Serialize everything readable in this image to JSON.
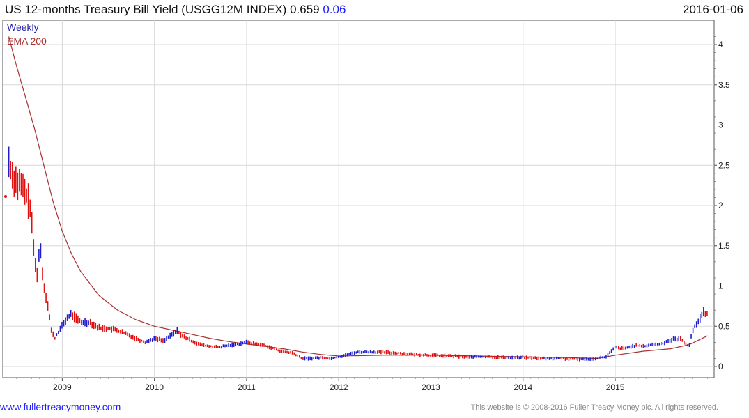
{
  "header": {
    "title": "US 12-months Treasury Bill Yield (USGG12M INDEX) 0.659",
    "change": "0.06",
    "date": "2016-01-06"
  },
  "legend": {
    "weekly": "Weekly",
    "ema": "EMA 200"
  },
  "footer": {
    "link": "www.fullertreacymoney.com",
    "copyright": "This website is © 2008-2016 Fuller Treacy Money plc. All rights reserved."
  },
  "colors": {
    "up_bar": "#1d1dcc",
    "down_bar": "#e01010",
    "ema_line": "#a83030",
    "grid": "#d8d8d8"
  },
  "chart_data": {
    "type": "line",
    "y_axis_side": "right",
    "ylim": [
      -0.1,
      4.3
    ],
    "yticks": [
      "0",
      "0.5",
      "1",
      "1.5",
      "2",
      "2.5",
      "3",
      "3.5",
      "4"
    ],
    "xticks": [
      "2009",
      "2010",
      "2011",
      "2012",
      "2013",
      "2014",
      "2015"
    ],
    "xlim": [
      2008.4,
      2016.02
    ],
    "grid": true,
    "series": [
      {
        "name": "Weekly",
        "x": [
          2008.42,
          2008.45,
          2008.5,
          2008.55,
          2008.6,
          2008.65,
          2008.68,
          2008.72,
          2008.76,
          2008.8,
          2008.84,
          2008.88,
          2008.92,
          2008.97,
          2009.05,
          2009.1,
          2009.2,
          2009.3,
          2009.4,
          2009.5,
          2009.6,
          2009.7,
          2009.8,
          2009.9,
          2010.0,
          2010.1,
          2010.2,
          2010.25,
          2010.3,
          2010.4,
          2010.5,
          2010.6,
          2010.7,
          2010.8,
          2010.9,
          2011.0,
          2011.1,
          2011.2,
          2011.3,
          2011.4,
          2011.5,
          2011.6,
          2011.7,
          2011.8,
          2011.9,
          2012.0,
          2012.2,
          2012.4,
          2012.6,
          2012.8,
          2013.0,
          2013.2,
          2013.4,
          2013.6,
          2013.8,
          2014.0,
          2014.2,
          2014.4,
          2014.6,
          2014.8,
          2014.9,
          2015.0,
          2015.1,
          2015.2,
          2015.3,
          2015.4,
          2015.5,
          2015.6,
          2015.7,
          2015.75,
          2015.8,
          2015.85,
          2015.9,
          2015.95,
          2016.0
        ],
        "values": [
          2.55,
          2.4,
          2.3,
          2.25,
          2.15,
          2.0,
          1.6,
          1.1,
          1.5,
          1.0,
          0.8,
          0.45,
          0.35,
          0.45,
          0.6,
          0.65,
          0.55,
          0.55,
          0.48,
          0.47,
          0.45,
          0.4,
          0.35,
          0.3,
          0.35,
          0.32,
          0.4,
          0.45,
          0.38,
          0.32,
          0.27,
          0.25,
          0.24,
          0.26,
          0.28,
          0.3,
          0.28,
          0.26,
          0.22,
          0.18,
          0.17,
          0.1,
          0.1,
          0.11,
          0.1,
          0.12,
          0.18,
          0.18,
          0.17,
          0.15,
          0.14,
          0.13,
          0.12,
          0.12,
          0.11,
          0.11,
          0.1,
          0.1,
          0.09,
          0.1,
          0.12,
          0.24,
          0.22,
          0.26,
          0.25,
          0.27,
          0.28,
          0.33,
          0.35,
          0.3,
          0.25,
          0.48,
          0.55,
          0.68,
          0.66
        ]
      },
      {
        "name": "EMA 200",
        "x": [
          2008.42,
          2008.5,
          2008.6,
          2008.7,
          2008.8,
          2008.9,
          2009.0,
          2009.1,
          2009.2,
          2009.4,
          2009.6,
          2009.8,
          2010.0,
          2010.2,
          2010.4,
          2010.6,
          2010.8,
          2011.0,
          2011.2,
          2011.4,
          2011.6,
          2011.8,
          2012.0,
          2012.5,
          2013.0,
          2013.5,
          2014.0,
          2014.5,
          2014.8,
          2015.0,
          2015.3,
          2015.6,
          2015.8,
          2016.0
        ],
        "values": [
          4.1,
          3.75,
          3.35,
          2.95,
          2.5,
          2.05,
          1.68,
          1.4,
          1.18,
          0.88,
          0.7,
          0.58,
          0.5,
          0.45,
          0.4,
          0.35,
          0.31,
          0.28,
          0.25,
          0.22,
          0.18,
          0.15,
          0.13,
          0.14,
          0.14,
          0.13,
          0.12,
          0.11,
          0.1,
          0.14,
          0.19,
          0.22,
          0.27,
          0.38
        ]
      }
    ]
  }
}
